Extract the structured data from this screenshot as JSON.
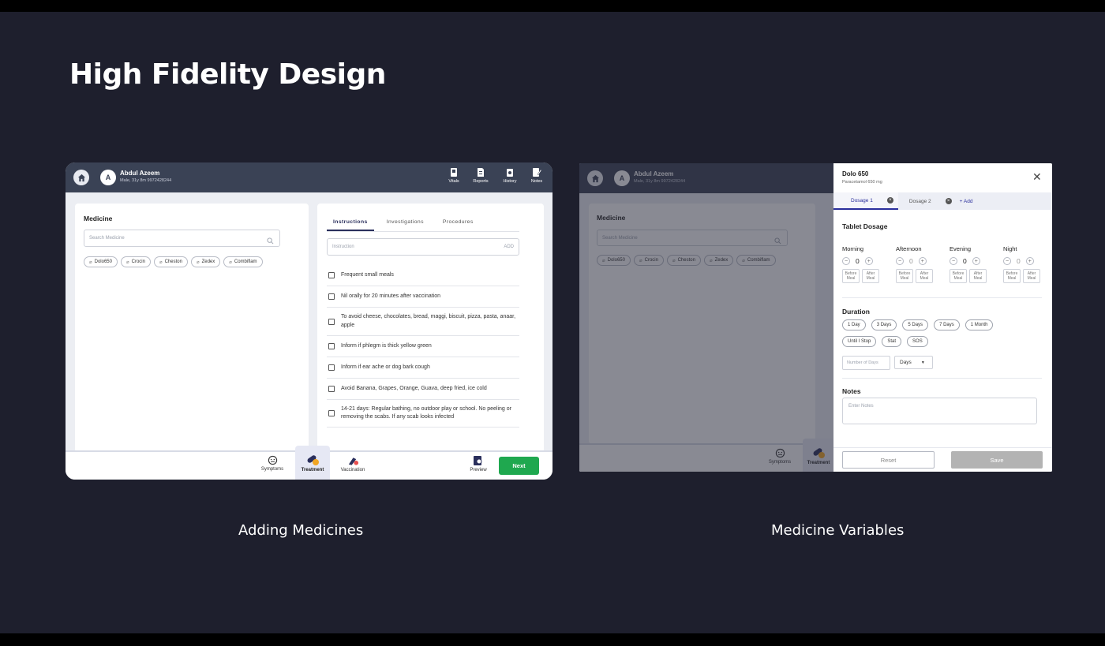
{
  "hero_title": "High Fidelity Design",
  "captions": {
    "left": "Adding Medicines",
    "right": "Medicine Variables"
  },
  "patient": {
    "initial": "A",
    "name": "Abdul Azeem",
    "meta": "Male, 31y 8m    9972428244"
  },
  "header_nav": [
    {
      "label": "Vitals",
      "icon": "vitals-icon"
    },
    {
      "label": "Reports",
      "icon": "reports-icon"
    },
    {
      "label": "History",
      "icon": "history-icon"
    },
    {
      "label": "Notes",
      "icon": "notes-icon"
    }
  ],
  "medicine": {
    "title": "Medicine",
    "search_placeholder": "Search Medicine",
    "chips": [
      "Dolo650",
      "Crocin",
      "Cheston",
      "Zedex",
      "Combiflam"
    ]
  },
  "tabs": [
    "Instructions",
    "Investigations",
    "Procedures"
  ],
  "instruction_input": {
    "placeholder": "Instruction",
    "add": "ADD"
  },
  "instructions": [
    "Frequent small meals",
    "Nil orally for 20 minutes after vaccination",
    "To avoid cheese, chocolates, bread, maggi, biscuit, pizza, pasta, anaar, apple",
    "Inform if phlegm is thick yellow green",
    "Inform if ear ache or dog bark cough",
    "Avoid Banana, Grapes, Orange, Guava, deep fried, ice cold",
    "14-21 days: Regular bathing, no outdoor play or school. No peeling or removing the scabs. If any scab looks infected"
  ],
  "footer_nav": [
    {
      "label": "Symptoms",
      "icon": "symptoms-icon"
    },
    {
      "label": "Treatment",
      "icon": "treatment-icon"
    },
    {
      "label": "Vaccination",
      "icon": "vaccination-icon"
    }
  ],
  "preview_label": "Preview",
  "next_label": "Next",
  "drawer": {
    "title": "Dolo 650",
    "subtitle": "Paracetamol 650 mg",
    "tab1": "Dosage 1",
    "tab2": "Dosage 2",
    "add_link": "+ Add",
    "tablet_dosage": "Tablet Dosage",
    "times": [
      {
        "label": "Morning",
        "value": "0"
      },
      {
        "label": "Afternoon",
        "value": "0"
      },
      {
        "label": "Evening",
        "value": "0"
      },
      {
        "label": "Night",
        "value": "0"
      }
    ],
    "before_meal": "Before Meal",
    "after_meal": "After Meal",
    "duration_title": "Duration",
    "durations_row1": [
      "1 Day",
      "3 Days",
      "5 Days",
      "7 Days",
      "1 Month"
    ],
    "durations_row2": [
      "Until I Stop",
      "Stat",
      "SOS"
    ],
    "number_of_days_placeholder": "Number of Days",
    "days_select": "Days",
    "notes_title": "Notes",
    "notes_placeholder": "Enter Notes",
    "reset_label": "Reset",
    "save_label": "Save"
  },
  "colors": {
    "background": "#1e1f2d",
    "header": "#3a4255",
    "primary_green": "#1fa84f",
    "accent": "#2a2f9c"
  }
}
